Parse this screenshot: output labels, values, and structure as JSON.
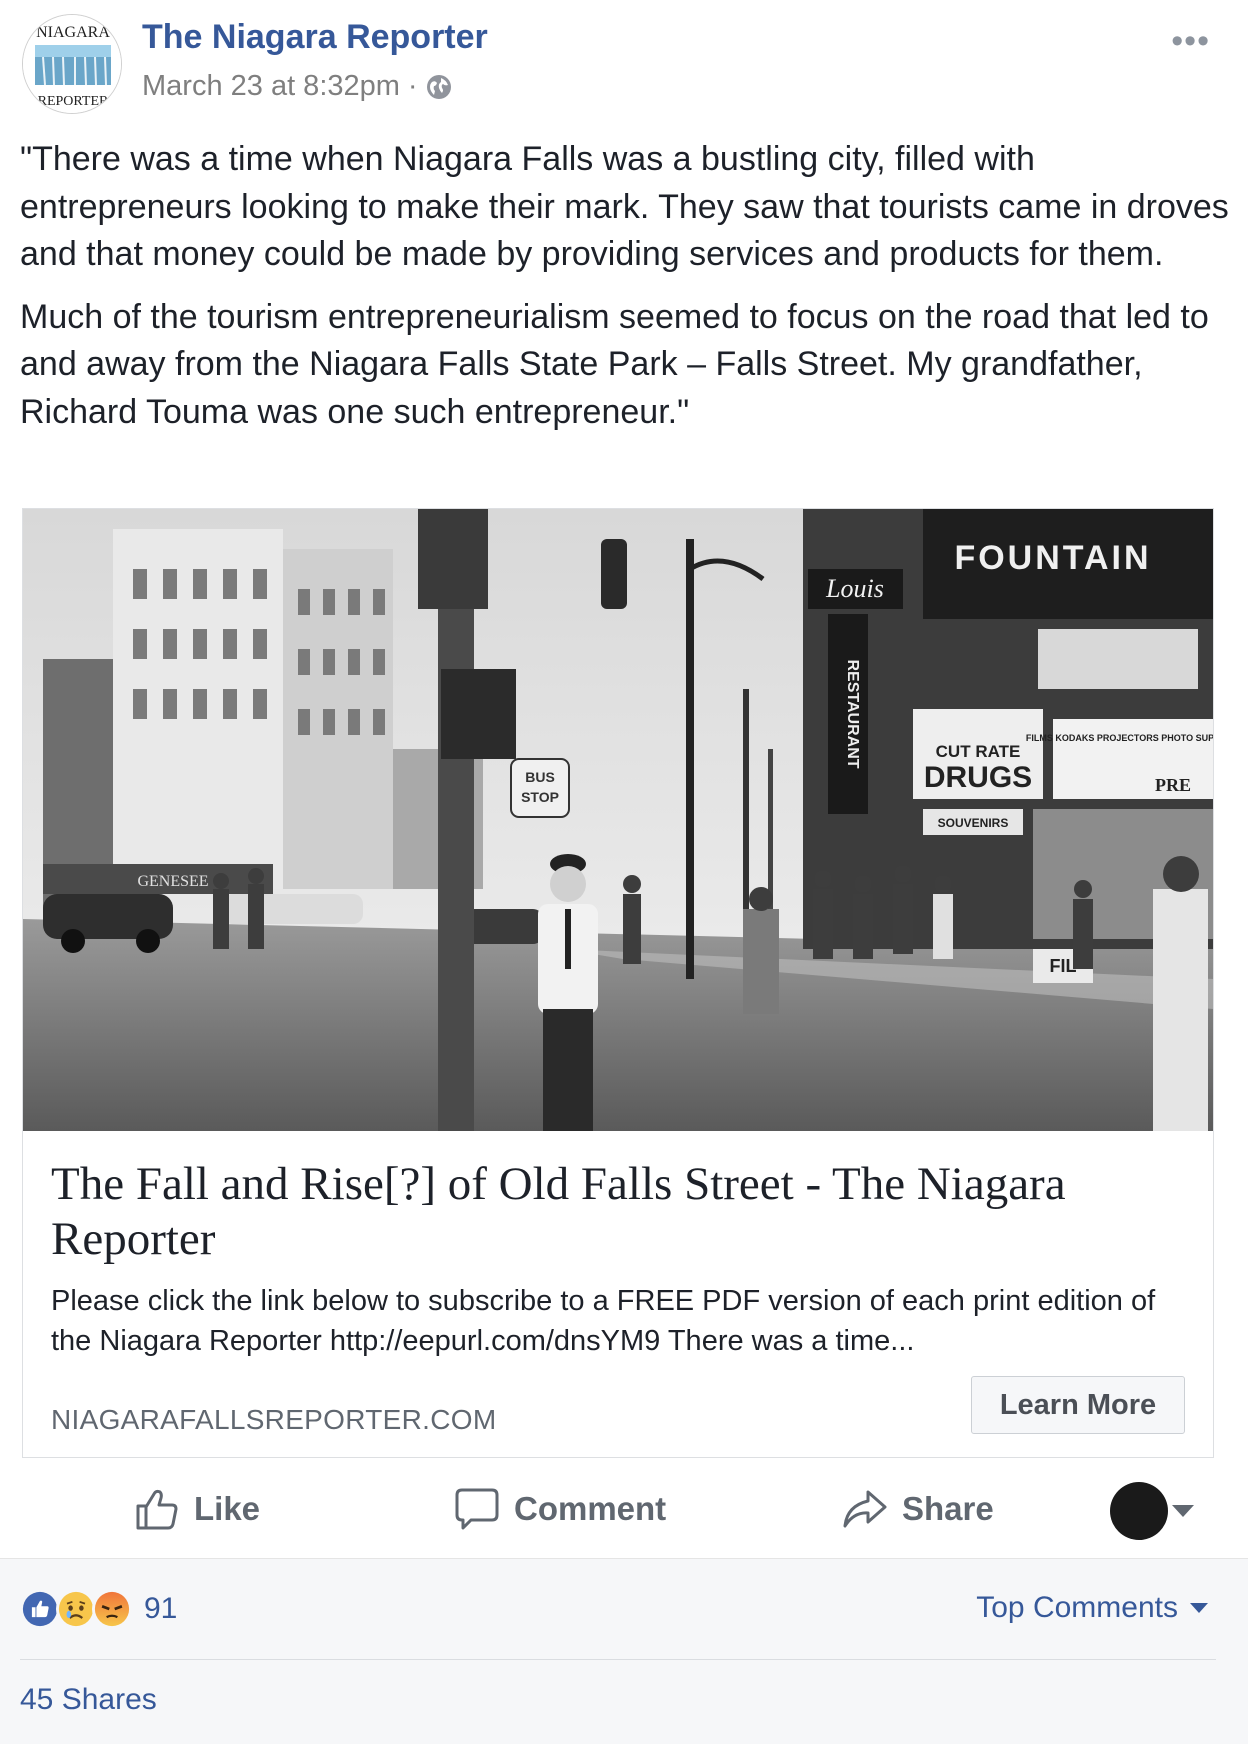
{
  "post": {
    "page_name": "The Niagara Reporter",
    "timestamp": "March 23 at 8:32pm",
    "separator": "·",
    "more_label": "•••",
    "avatar_logo_text_top": "NIAGARA",
    "avatar_logo_text_bottom": "REPORTER",
    "paragraphs": [
      "\"There was a time when Niagara Falls was a bustling city, filled with entrepreneurs looking to make their mark. They saw that tourists came in droves and that money could be made by providing services and products for them.",
      "Much of the tourism entrepreneurialism seemed to focus on the road that led to and away from the Niagara Falls State Park – Falls Street. My grandfather, Richard Touma was one such entrepreneur.\""
    ]
  },
  "card": {
    "image_signs": {
      "fountain": "FOUNTAIN",
      "louis": "Louis",
      "restaurant": "RESTAURANT",
      "bus_stop_1": "BUS",
      "bus_stop_2": "STOP",
      "cut_rate": "CUT RATE",
      "drugs": "DRUGS",
      "souvenirs": "SOUVENIRS",
      "genesee": "GENESEE",
      "film": "FIL",
      "pre": "PRE",
      "films_sign": "FILMS KODAKS PROJECTORS PHOTO SUPPLIES"
    },
    "title": "The Fall and Rise[?] of Old Falls Street - The Niagara Reporter",
    "description": "Please click the link below to subscribe to a FREE PDF version of each print edition of the Niagara Reporter http://eepurl.com/dnsYM9 There was a time...",
    "domain": "NIAGARAFALLSREPORTER.COM",
    "cta_label": "Learn More"
  },
  "actions": {
    "like_label": "Like",
    "comment_label": "Comment",
    "share_label": "Share"
  },
  "footer": {
    "reaction_count": "91",
    "reactions": [
      "like",
      "sad",
      "angry"
    ],
    "top_comments_label": "Top Comments",
    "shares_label": "45 Shares"
  },
  "colors": {
    "link_blue": "#365899",
    "like_blue": "#4267b2",
    "reaction_yellow": "#f7c64b",
    "angry_orange": "#f0753a"
  }
}
